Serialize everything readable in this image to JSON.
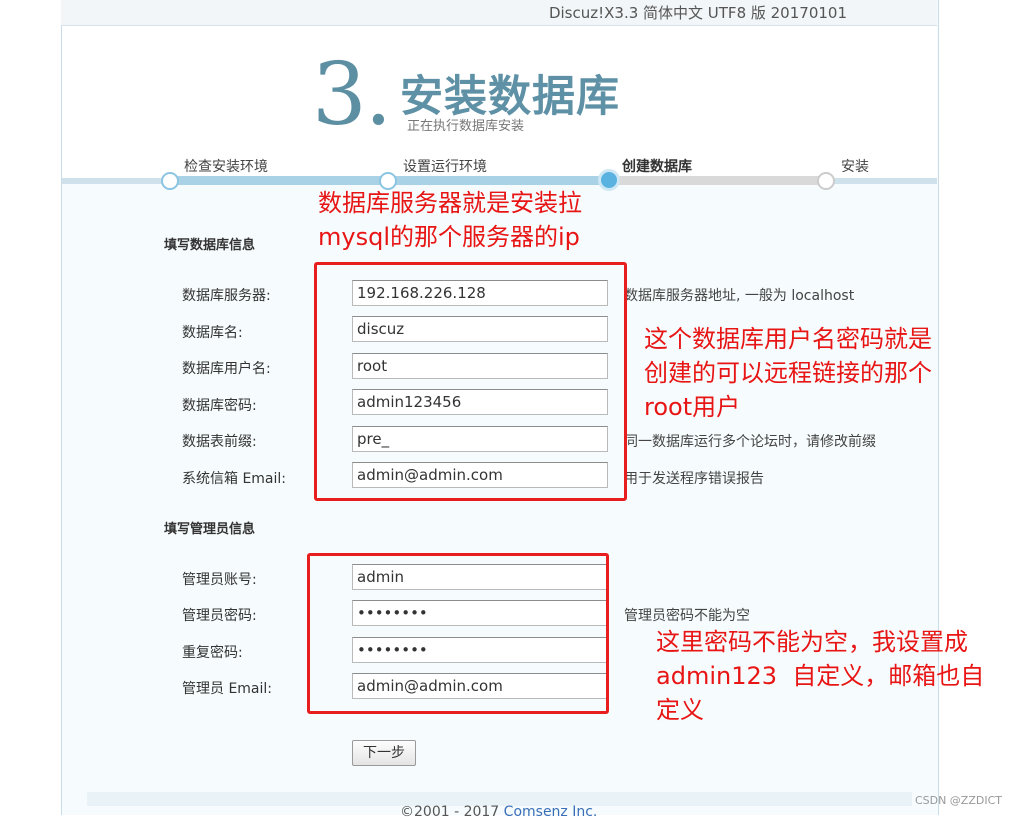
{
  "version_text": "Discuz!X3.3 简体中文 UTF8 版 20170101",
  "header": {
    "step_number": "3.",
    "step_title": "安装数据库",
    "step_subtitle": "正在执行数据库安装"
  },
  "steps": [
    {
      "label": "检查安装环境",
      "state": "done"
    },
    {
      "label": "设置运行环境",
      "state": "done"
    },
    {
      "label": "创建数据库",
      "state": "current"
    },
    {
      "label": "安装",
      "state": "pending"
    }
  ],
  "db_section": {
    "title": "填写数据库信息",
    "fields": [
      {
        "label": "数据库服务器:",
        "value": "192.168.226.128",
        "hint": "数据库服务器地址, 一般为 localhost"
      },
      {
        "label": "数据库名:",
        "value": "discuz",
        "hint": ""
      },
      {
        "label": "数据库用户名:",
        "value": "root",
        "hint": ""
      },
      {
        "label": "数据库密码:",
        "value": "admin123456",
        "hint": ""
      },
      {
        "label": "数据表前缀:",
        "value": "pre_",
        "hint": "同一数据库运行多个论坛时，请修改前缀"
      },
      {
        "label": "系统信箱 Email:",
        "value": "admin@admin.com",
        "hint": "用于发送程序错误报告"
      }
    ]
  },
  "admin_section": {
    "title": "填写管理员信息",
    "fields": [
      {
        "label": "管理员账号:",
        "value": "admin",
        "hint": ""
      },
      {
        "label": "管理员密码:",
        "value": "••••••••",
        "hint": "管理员密码不能为空"
      },
      {
        "label": "重复密码:",
        "value": "••••••••",
        "hint": ""
      },
      {
        "label": "管理员 Email:",
        "value": "admin@admin.com",
        "hint": ""
      }
    ]
  },
  "next_button": "下一步",
  "footer": {
    "prefix": "©2001 - 2017 ",
    "link": "Comsenz Inc."
  },
  "annotations": {
    "note1": [
      "数据库服务器就是安装拉",
      "mysql的那个服务器的ip"
    ],
    "note2": [
      "这个数据库用户名密码就是",
      "创建的可以远程链接的那个",
      "root用户"
    ],
    "note3": [
      "这里密码不能为空，我设置成",
      "admin123  自定义，邮箱也自",
      "定义"
    ]
  },
  "watermark": "CSDN @ZZDICT",
  "colors": {
    "accent": "#5e91a5",
    "annotation_red": "#e81e1e",
    "progress": "#a9d2e7"
  }
}
